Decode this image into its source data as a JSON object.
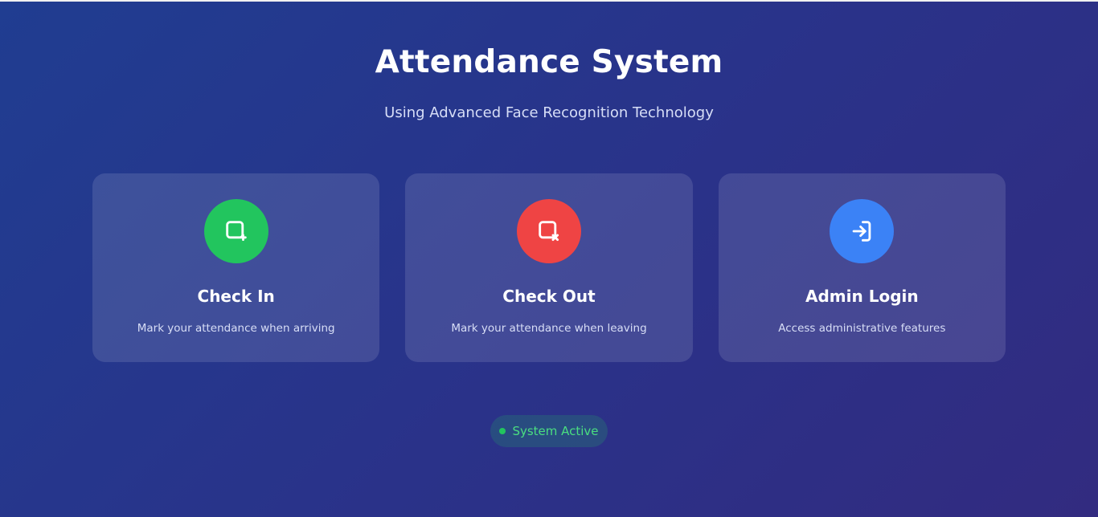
{
  "header": {
    "title": "Attendance System",
    "subtitle": "Using Advanced Face Recognition Technology"
  },
  "cards": [
    {
      "title": "Check In",
      "description": "Mark your attendance when arriving",
      "icon": "check-in-icon",
      "color": "#22c55e"
    },
    {
      "title": "Check Out",
      "description": "Mark your attendance when leaving",
      "icon": "check-out-icon",
      "color": "#ef4444"
    },
    {
      "title": "Admin Login",
      "description": "Access administrative features",
      "icon": "admin-login-icon",
      "color": "#3b82f6"
    }
  ],
  "status": {
    "label": "System Active",
    "color": "#4ade80",
    "dot_color": "#22c55e"
  },
  "theme": {
    "background_start": "#203d91",
    "background_end": "#322b80",
    "text_primary": "#ffffff",
    "text_secondary": "#d8def6"
  }
}
